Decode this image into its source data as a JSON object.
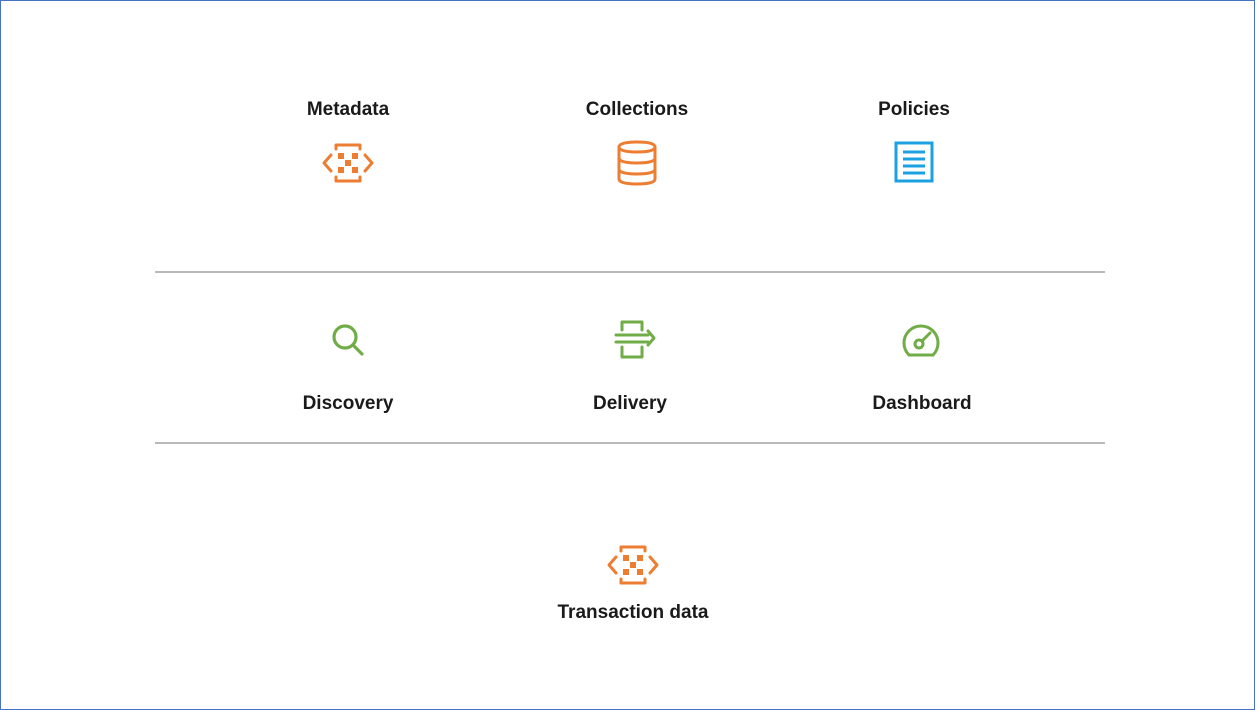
{
  "top_row": [
    {
      "label": "Metadata",
      "icon": "metadata-code-icon",
      "color": "#ed7d31"
    },
    {
      "label": "Collections",
      "icon": "database-icon",
      "color": "#ed7d31"
    },
    {
      "label": "Policies",
      "icon": "document-list-icon",
      "color": "#1ba1e2"
    }
  ],
  "middle_row": [
    {
      "label": "Discovery",
      "icon": "search-icon",
      "color": "#70ad47"
    },
    {
      "label": "Delivery",
      "icon": "delivery-arrow-icon",
      "color": "#70ad47"
    },
    {
      "label": "Dashboard",
      "icon": "gauge-icon",
      "color": "#70ad47"
    }
  ],
  "bottom_row": [
    {
      "label": "Transaction data",
      "icon": "transaction-code-icon",
      "color": "#ed7d31"
    }
  ]
}
